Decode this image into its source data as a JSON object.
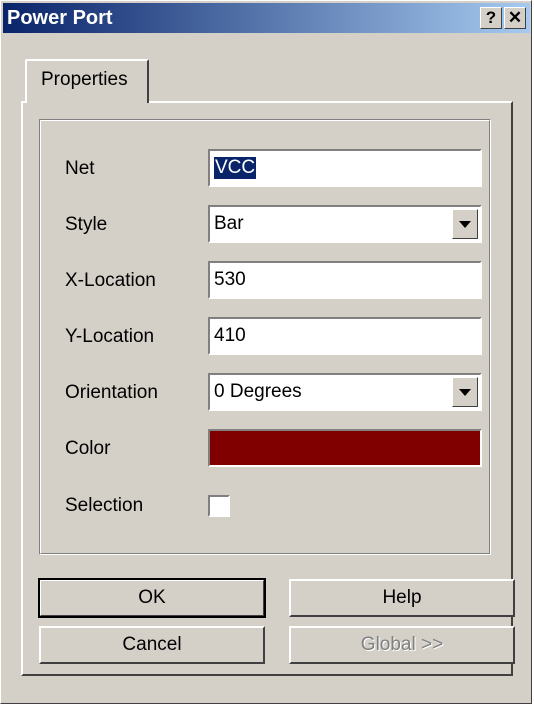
{
  "window": {
    "title": "Power Port",
    "help_button": "?",
    "close_button": "✕"
  },
  "tabs": [
    {
      "label": "Properties"
    }
  ],
  "properties": {
    "net": {
      "label": "Net",
      "value": "VCC"
    },
    "style": {
      "label": "Style",
      "value": "Bar"
    },
    "x_location": {
      "label": "X-Location",
      "value": "530"
    },
    "y_location": {
      "label": "Y-Location",
      "value": "410"
    },
    "orientation": {
      "label": "Orientation",
      "value": "0 Degrees"
    },
    "color": {
      "label": "Color",
      "value": "#800000"
    },
    "selection": {
      "label": "Selection",
      "checked": false
    }
  },
  "buttons": {
    "ok": "OK",
    "help": "Help",
    "cancel": "Cancel",
    "global": "Global >>"
  }
}
